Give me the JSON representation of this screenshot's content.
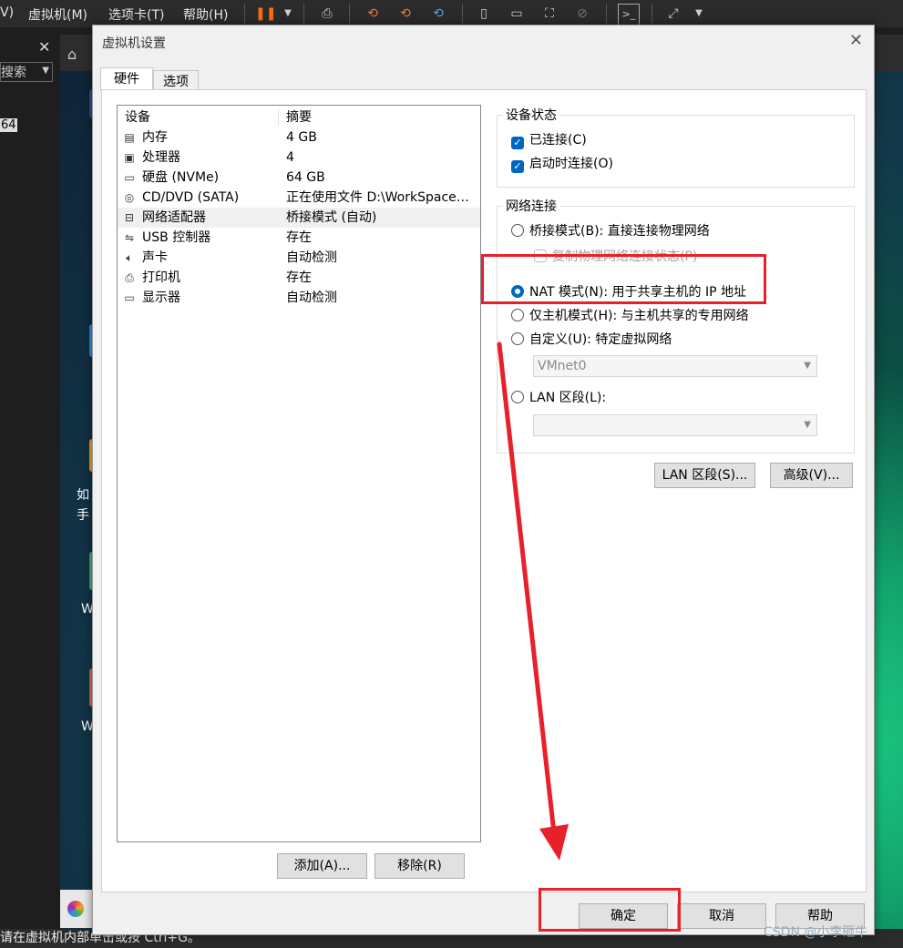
{
  "host": {
    "menu": [
      "V)",
      "虚拟机(M)",
      "选项卡(T)",
      "帮助(H)"
    ],
    "left_search_placeholder": "搜索",
    "left_item": "64",
    "desktop_labels": [
      "如",
      "手",
      "W",
      "W"
    ],
    "status_text": "请在虚拟机内部单击或按 Ctrl+G。"
  },
  "dialog": {
    "title": "虚拟机设置",
    "tabs": [
      "硬件",
      "选项"
    ],
    "device_table": {
      "headers": [
        "设备",
        "摘要"
      ],
      "rows": [
        {
          "icon": "memory-icon",
          "device": "内存",
          "summary": "4 GB"
        },
        {
          "icon": "cpu-icon",
          "device": "处理器",
          "summary": "4"
        },
        {
          "icon": "disk-icon",
          "device": "硬盘 (NVMe)",
          "summary": "64 GB"
        },
        {
          "icon": "cd-icon",
          "device": "CD/DVD (SATA)",
          "summary": "正在使用文件 D:\\WorkSpace…"
        },
        {
          "icon": "network-icon",
          "device": "网络适配器",
          "summary": "桥接模式 (自动)"
        },
        {
          "icon": "usb-icon",
          "device": "USB 控制器",
          "summary": "存在"
        },
        {
          "icon": "sound-icon",
          "device": "声卡",
          "summary": "自动检测"
        },
        {
          "icon": "printer-icon",
          "device": "打印机",
          "summary": "存在"
        },
        {
          "icon": "display-icon",
          "device": "显示器",
          "summary": "自动检测"
        }
      ],
      "selected_row": 4
    },
    "add_button": "添加(A)...",
    "remove_button": "移除(R)",
    "device_status": {
      "legend": "设备状态",
      "connected": "已连接(C)",
      "connect_at_power_on": "启动时连接(O)"
    },
    "network": {
      "legend": "网络连接",
      "bridged": "桥接模式(B): 直接连接物理网络",
      "replicate": "复制物理网络连接状态(P)",
      "nat": "NAT 模式(N): 用于共享主机的 IP 地址",
      "host_only": "仅主机模式(H): 与主机共享的专用网络",
      "custom": "自定义(U): 特定虚拟网络",
      "custom_select": "VMnet0",
      "lan_segment": "LAN 区段(L):",
      "lan_select": "",
      "selected": "nat"
    },
    "lan_segments_button": "LAN 区段(S)...",
    "advanced_button": "高级(V)...",
    "ok_button": "确定",
    "cancel_button": "取消",
    "help_button": "帮助"
  },
  "watermark": "CSDN @小李砸牛",
  "colors": {
    "accent": "#0067c0",
    "annotation_red": "#e8202a"
  }
}
